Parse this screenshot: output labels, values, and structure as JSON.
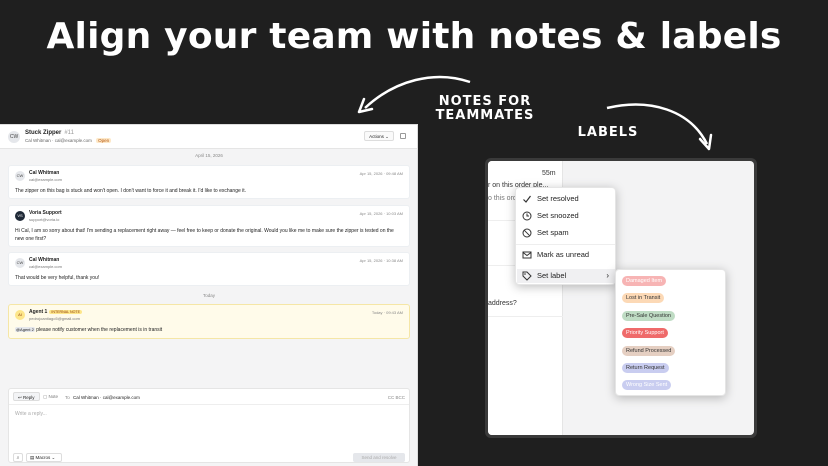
{
  "headline": "Align your team with notes & labels",
  "callouts": {
    "notes": "NOTES FOR TEAMMATES",
    "labels": "LABELS"
  },
  "conversation": {
    "avatar": "CW",
    "title": "Stuck Zipper",
    "number": "#11",
    "customer": "Cal Whitman",
    "email": "cal@example.com",
    "status": "Open",
    "actions_label": "Actions",
    "date_separator": "April 15, 2026",
    "today_separator": "Today"
  },
  "messages": [
    {
      "avatar": "CW",
      "name": "Cal Whitman",
      "email": "cal@example.com",
      "time": "Apr 15, 2026 · 09:48 AM",
      "body": "The zipper on this bag is stuck and won't open. I don't want to force it and break it. I'd like to exchange it."
    },
    {
      "avatar": "VS",
      "name": "Voria Support",
      "email": "support@voria.io",
      "time": "Apr 15, 2026 · 10:03 AM",
      "body": "Hi Cal, I am so sorry about that! I'm sending a replacement right away — feel free to keep or donate the original. Would you like me to make sure the zipper is tested on the new one first?"
    },
    {
      "avatar": "CW",
      "name": "Cal Whitman",
      "email": "cal@example.com",
      "time": "Apr 15, 2026 · 10:38 AM",
      "body": "That would be very helpful, thank you!"
    }
  ],
  "note": {
    "avatar": "AI",
    "name": "Agent 1",
    "badge": "INTERNAL NOTE",
    "email": "pedrojoantiago5@gmail.com",
    "time": "Today · 09:43 AM",
    "mention": "@Agent 2",
    "body": "please notify customer when the replacement is in transit"
  },
  "composer": {
    "reply_tab": "Reply",
    "note_tab": "Note",
    "to_label": "To",
    "to_value": "Cal Whitman · cal@example.com",
    "cc_bcc": "CC  BCC",
    "placeholder": "Write a reply...",
    "macros_label": "Macros",
    "send_label": "Send and resolve"
  },
  "right_list": {
    "time": "55m",
    "line1": "r on this order ple...",
    "line2": "o this ord",
    "line3": "address?"
  },
  "context_menu": {
    "items": [
      {
        "label": "Set resolved",
        "icon": "check-icon"
      },
      {
        "label": "Set snoozed",
        "icon": "clock-icon"
      },
      {
        "label": "Set spam",
        "icon": "block-icon"
      },
      {
        "label": "Mark as unread",
        "icon": "mail-icon"
      },
      {
        "label": "Set label",
        "icon": "tag-icon"
      }
    ]
  },
  "labels": [
    {
      "text": "Damaged Item",
      "bg": "#f7b4b4",
      "fg": "#ffffff"
    },
    {
      "text": "Lost in Transit",
      "bg": "#fcd9b6",
      "fg": "#333333"
    },
    {
      "text": "Pre-Sale Question",
      "bg": "#bfdcc4",
      "fg": "#333333"
    },
    {
      "text": "Priority Support",
      "bg": "#ef6a6a",
      "fg": "#ffffff"
    },
    {
      "text": "Refund Processed",
      "bg": "#e5cfc2",
      "fg": "#333333"
    },
    {
      "text": "Return Request",
      "bg": "#c9cdf0",
      "fg": "#333333"
    },
    {
      "text": "Wrong Size Sent",
      "bg": "#c9cdf0",
      "fg": "#ffffff"
    }
  ]
}
